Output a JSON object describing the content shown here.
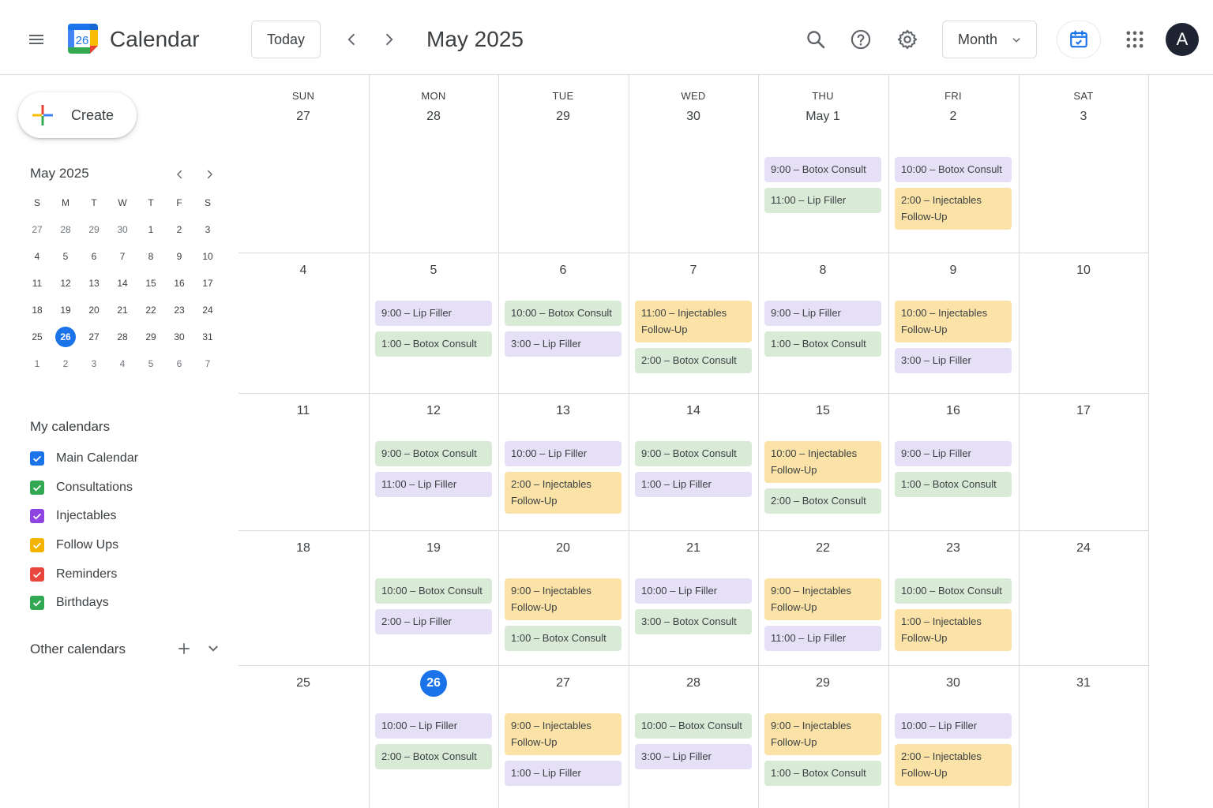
{
  "header": {
    "app_title": "Calendar",
    "logo_day": "26",
    "today_label": "Today",
    "period_title": "May 2025",
    "view_label": "Month",
    "avatar_initial": "A",
    "icons": [
      "menu-icon",
      "prev-icon",
      "next-icon",
      "search-icon",
      "help-icon",
      "settings-icon",
      "chevron-down-icon",
      "tasks-icon",
      "apps-icon"
    ]
  },
  "sidebar": {
    "create_label": "Create",
    "mini_title": "May 2025",
    "mini_weekdays": [
      "S",
      "M",
      "T",
      "W",
      "T",
      "F",
      "S"
    ],
    "mini_weeks": [
      [
        "27",
        "28",
        "29",
        "30",
        "1",
        "2",
        "3"
      ],
      [
        "4",
        "5",
        "6",
        "7",
        "8",
        "9",
        "10"
      ],
      [
        "11",
        "12",
        "13",
        "14",
        "15",
        "16",
        "17"
      ],
      [
        "18",
        "19",
        "20",
        "21",
        "22",
        "23",
        "24"
      ],
      [
        "25",
        "26",
        "27",
        "28",
        "29",
        "30",
        "31"
      ],
      [
        "1",
        "2",
        "3",
        "4",
        "5",
        "6",
        "7"
      ]
    ],
    "mini_selected": "26",
    "my_calendars_title": "My calendars",
    "calendars": [
      {
        "label": "Main Calendar",
        "color": "#1a73e8"
      },
      {
        "label": "Consultations",
        "color": "#33a853"
      },
      {
        "label": "Injectables",
        "color": "#8e44e0"
      },
      {
        "label": "Follow Ups",
        "color": "#f4b400"
      },
      {
        "label": "Reminders",
        "color": "#e8453c"
      },
      {
        "label": "Birthdays",
        "color": "#33a853"
      }
    ],
    "other_calendars_title": "Other calendars"
  },
  "month": {
    "weekdays": [
      "SUN",
      "MON",
      "TUE",
      "WED",
      "THU",
      "FRI",
      "SAT"
    ],
    "weeks": [
      {
        "days": [
          "27",
          "28",
          "29",
          "30",
          "May 1",
          "2",
          "3"
        ],
        "events": [
          [],
          [],
          [],
          [],
          [
            {
              "text": "9:00 – Botox Consult",
              "kind": "purple"
            },
            {
              "text": "11:00 – Lip Filler",
              "kind": "green"
            }
          ],
          [
            {
              "text": "10:00 – Botox Consult",
              "kind": "purple"
            },
            {
              "text": "2:00 – Injectables Follow-Up",
              "kind": "yellow"
            }
          ],
          []
        ]
      },
      {
        "days": [
          "4",
          "5",
          "6",
          "7",
          "8",
          "9",
          "10"
        ],
        "events": [
          [],
          [
            {
              "text": "9:00 – Lip Filler",
              "kind": "purple"
            },
            {
              "text": "1:00 – Botox Consult",
              "kind": "green"
            }
          ],
          [
            {
              "text": "10:00 – Botox Consult",
              "kind": "green"
            },
            {
              "text": "3:00 – Lip Filler",
              "kind": "purple"
            }
          ],
          [
            {
              "text": "11:00 – Injectables Follow-Up",
              "kind": "yellow"
            },
            {
              "text": "2:00 – Botox Consult",
              "kind": "green"
            }
          ],
          [
            {
              "text": "9:00 – Lip Filler",
              "kind": "purple"
            },
            {
              "text": "1:00 – Botox Consult",
              "kind": "green"
            }
          ],
          [
            {
              "text": "10:00 – Injectables Follow-Up",
              "kind": "yellow"
            },
            {
              "text": "3:00 – Lip Filler",
              "kind": "purple"
            }
          ],
          []
        ]
      },
      {
        "days": [
          "11",
          "12",
          "13",
          "14",
          "15",
          "16",
          "17"
        ],
        "events": [
          [],
          [
            {
              "text": "9:00 – Botox Consult",
              "kind": "green"
            },
            {
              "text": "11:00 – Lip Filler",
              "kind": "purple"
            }
          ],
          [
            {
              "text": "10:00 – Lip Filler",
              "kind": "purple"
            },
            {
              "text": "2:00 – Injectables Follow-Up",
              "kind": "yellow"
            }
          ],
          [
            {
              "text": "9:00 – Botox Consult",
              "kind": "green"
            },
            {
              "text": "1:00 – Lip Filler",
              "kind": "purple"
            }
          ],
          [
            {
              "text": "10:00 – Injectables Follow-Up",
              "kind": "yellow"
            },
            {
              "text": "2:00 – Botox Consult",
              "kind": "green"
            }
          ],
          [
            {
              "text": "9:00 – Lip Filler",
              "kind": "purple"
            },
            {
              "text": "1:00 – Botox Consult",
              "kind": "green"
            }
          ],
          []
        ]
      },
      {
        "days": [
          "18",
          "19",
          "20",
          "21",
          "22",
          "23",
          "24"
        ],
        "events": [
          [],
          [
            {
              "text": "10:00 – Botox Consult",
              "kind": "green"
            },
            {
              "text": "2:00 – Lip Filler",
              "kind": "purple"
            }
          ],
          [
            {
              "text": "9:00 – Injectables Follow-Up",
              "kind": "yellow"
            },
            {
              "text": "1:00 – Botox Consult",
              "kind": "green"
            }
          ],
          [
            {
              "text": "10:00 – Lip Filler",
              "kind": "purple"
            },
            {
              "text": "3:00 – Botox Consult",
              "kind": "green"
            }
          ],
          [
            {
              "text": "9:00 – Injectables Follow-Up",
              "kind": "yellow"
            },
            {
              "text": "11:00 – Lip Filler",
              "kind": "purple"
            }
          ],
          [
            {
              "text": "10:00 – Botox Consult",
              "kind": "green"
            },
            {
              "text": "1:00 – Injectables Follow-Up",
              "kind": "yellow"
            }
          ],
          []
        ]
      },
      {
        "days": [
          "25",
          "26",
          "27",
          "28",
          "29",
          "30",
          "31"
        ],
        "events": [
          [],
          [
            {
              "text": "10:00 – Lip Filler",
              "kind": "purple"
            },
            {
              "text": "2:00 – Botox Consult",
              "kind": "green"
            }
          ],
          [
            {
              "text": "9:00 – Injectables Follow-Up",
              "kind": "yellow"
            },
            {
              "text": "1:00 – Lip Filler",
              "kind": "purple"
            }
          ],
          [
            {
              "text": "10:00 – Botox Consult",
              "kind": "green"
            },
            {
              "text": "3:00 – Lip Filler",
              "kind": "purple"
            }
          ],
          [
            {
              "text": "9:00 – Injectables Follow-Up",
              "kind": "yellow"
            },
            {
              "text": "1:00 – Botox Consult",
              "kind": "green"
            }
          ],
          [
            {
              "text": "10:00 – Lip Filler",
              "kind": "purple"
            },
            {
              "text": "2:00 – Injectables Follow-Up",
              "kind": "yellow"
            }
          ],
          []
        ]
      }
    ],
    "today_day": "26",
    "colors": {
      "purple": "#e6e0f7",
      "green": "#d9ead7",
      "yellow": "#fbe3a7",
      "accent": "#1a73e8"
    }
  }
}
